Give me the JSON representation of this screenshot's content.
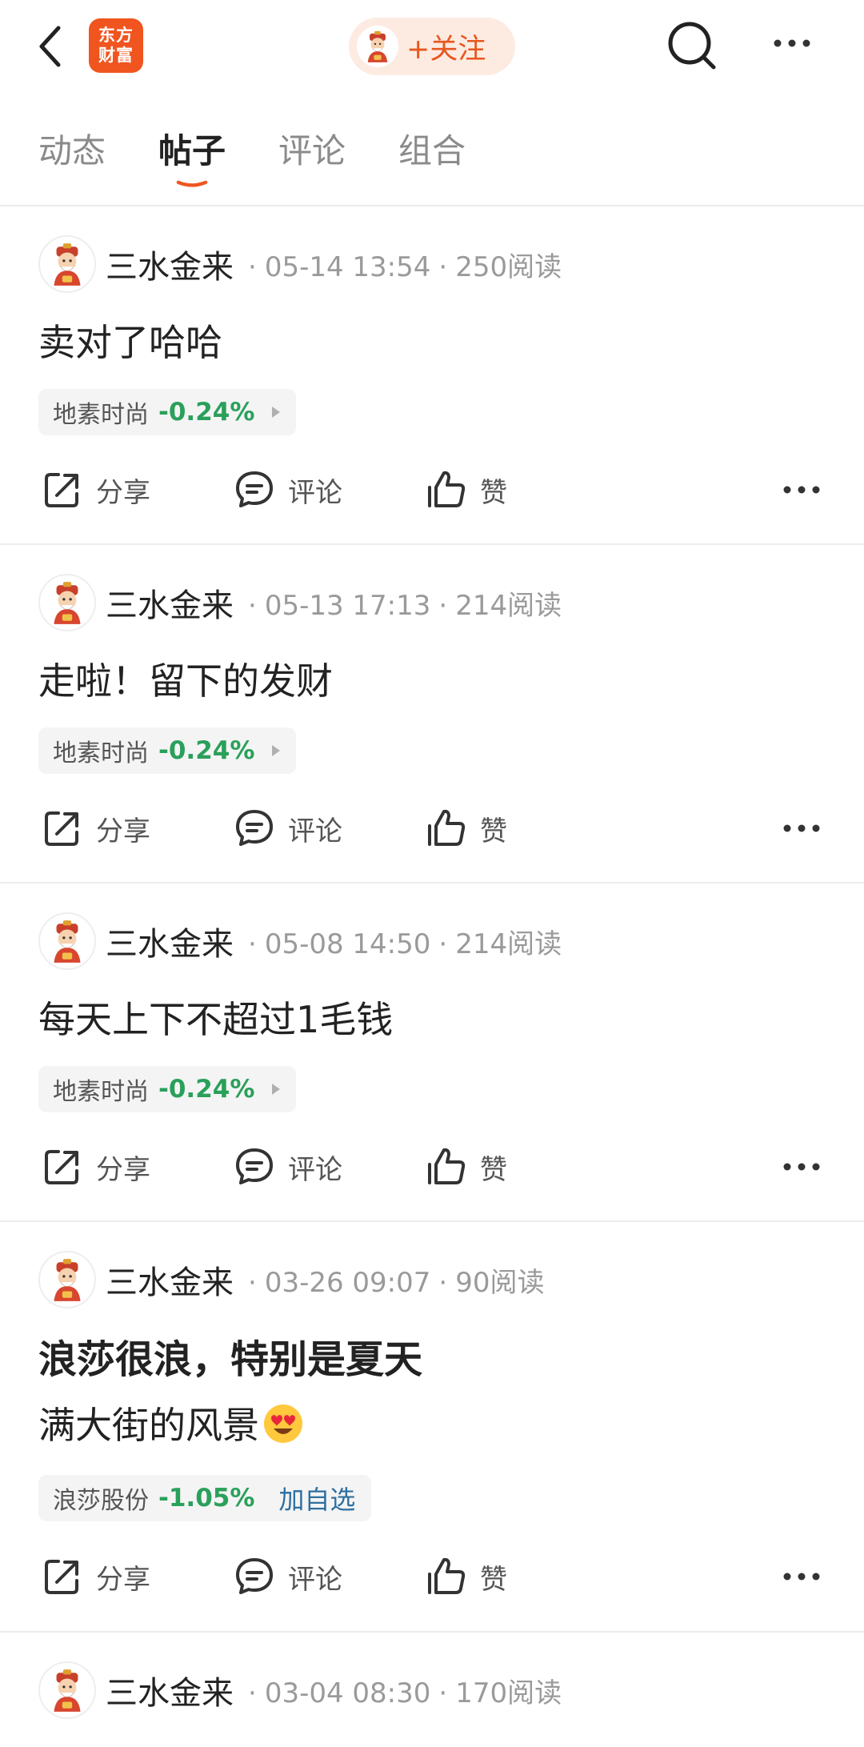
{
  "header": {
    "logo_line1": "东方",
    "logo_line2": "财富",
    "follow_label": "+关注",
    "colors": {
      "brand": "#f0551f",
      "follow_bg": "#fdebe2",
      "down_green": "#2aa05a",
      "link_blue": "#2f6f9f"
    }
  },
  "tabs": [
    {
      "label": "动态"
    },
    {
      "label": "帖子"
    },
    {
      "label": "评论"
    },
    {
      "label": "组合"
    }
  ],
  "active_tab": "帖子",
  "actions": {
    "share": "分享",
    "comment": "评论",
    "like": "赞"
  },
  "posts": [
    {
      "author": "三水金来",
      "date": "05-14 13:54",
      "reads": "250阅读",
      "text": "卖对了哈哈",
      "stock": {
        "name": "地素时尚",
        "change": "-0.24%"
      }
    },
    {
      "author": "三水金来",
      "date": "05-13 17:13",
      "reads": "214阅读",
      "text": "走啦！留下的发财",
      "stock": {
        "name": "地素时尚",
        "change": "-0.24%"
      }
    },
    {
      "author": "三水金来",
      "date": "05-08 14:50",
      "reads": "214阅读",
      "text": "每天上下不超过1毛钱",
      "stock": {
        "name": "地素时尚",
        "change": "-0.24%"
      }
    },
    {
      "author": "三水金来",
      "date": "03-26 09:07",
      "reads": "90阅读",
      "title": "浪莎很浪，特别是夏天",
      "text": "满大街的风景",
      "text_emoji": "heart-eyes-emoji",
      "stock": {
        "name": "浪莎股份",
        "change": "-1.05%",
        "add_watch": "加自选"
      }
    },
    {
      "author": "三水金来",
      "date": "03-04 08:30",
      "reads": "170阅读"
    }
  ],
  "icons": {
    "back": "chevron-left-icon",
    "search": "search-icon",
    "more": "more-dots-icon",
    "share": "share-icon",
    "comment": "comment-bubble-icon",
    "like": "thumbs-up-icon",
    "avatar": "fortune-god-avatar"
  }
}
